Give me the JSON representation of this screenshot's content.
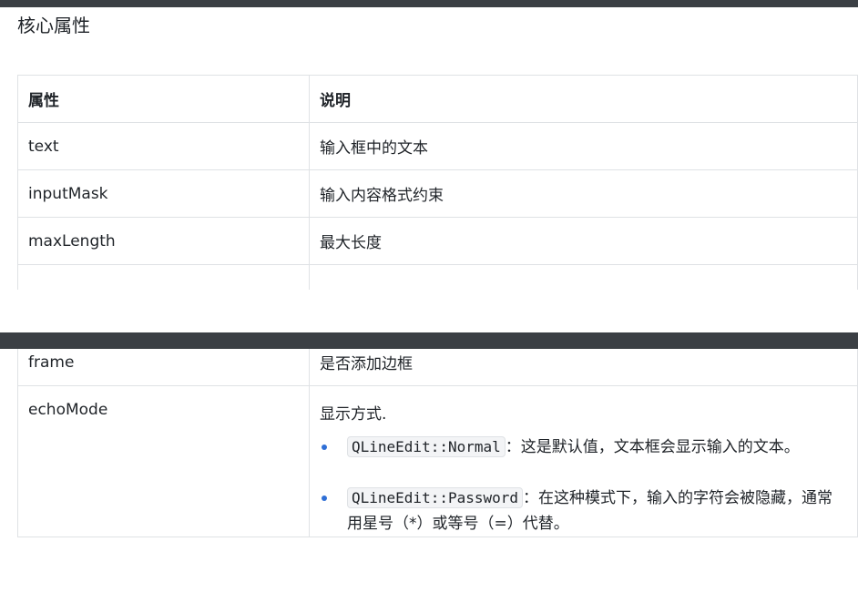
{
  "heading": "核心属性",
  "table_top": {
    "headers": [
      "属性",
      "说明"
    ],
    "rows": [
      {
        "name": "text",
        "desc": "输入框中的文本"
      },
      {
        "name": "inputMask",
        "desc": "输入内容格式约束"
      },
      {
        "name": "maxLength",
        "desc": "最大长度"
      }
    ]
  },
  "table_bottom": {
    "frame": {
      "name": "frame",
      "desc": "是否添加边框"
    },
    "echo": {
      "name": "echoMode",
      "desc": "显示方式.",
      "items": [
        {
          "code": "QLineEdit::Normal",
          "text": "：这是默认值，文本框会显示输入的文本。"
        },
        {
          "code": "QLineEdit::Password",
          "text": "：在这种模式下，输入的字符会被隐藏，通常用星号（*）或等号（=）代替。"
        }
      ]
    }
  }
}
